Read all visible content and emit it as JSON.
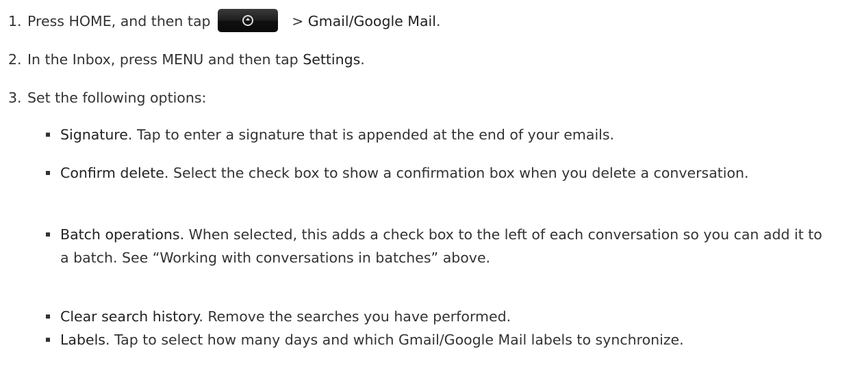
{
  "steps": [
    {
      "num": "1.",
      "pre": "Press HOME, and then tap",
      "icon": "all-apps-button-icon",
      "mid": " > ",
      "target": "Gmail/Google Mail",
      "post": "."
    },
    {
      "num": "2.",
      "pre": "In the Inbox, press MENU and then tap ",
      "target": "Settings",
      "post": "."
    },
    {
      "num": "3.",
      "text": "Set the following options:"
    }
  ],
  "options": [
    {
      "term": "Signature",
      "desc": ". Tap to enter a signature that is appended at the end of your emails."
    },
    {
      "term": "Confirm delete",
      "desc": ". Select the check box to show a confirmation box when you delete a conversation."
    },
    {
      "term": "Batch operations",
      "desc": ". When selected, this adds a check box to the left of each conversation so you can add it to a batch. See “Working with conversations in batches” above."
    },
    {
      "term": "Clear search history",
      "desc": ". Remove the searches you have performed."
    },
    {
      "term": "Labels",
      "desc": ". Tap to select how many days and which Gmail/Google Mail labels to synchronize."
    }
  ]
}
